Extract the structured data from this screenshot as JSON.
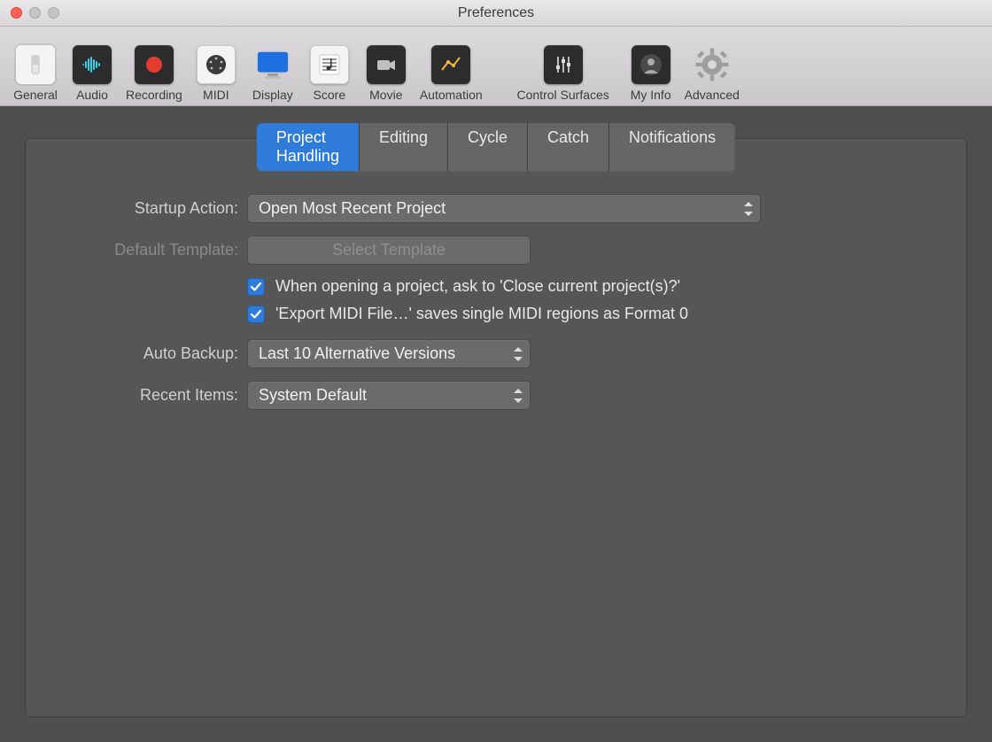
{
  "window": {
    "title": "Preferences"
  },
  "toolbar": {
    "items": [
      {
        "label": "General"
      },
      {
        "label": "Audio"
      },
      {
        "label": "Recording"
      },
      {
        "label": "MIDI"
      },
      {
        "label": "Display"
      },
      {
        "label": "Score"
      },
      {
        "label": "Movie"
      },
      {
        "label": "Automation"
      },
      {
        "label": "Control Surfaces"
      },
      {
        "label": "My Info"
      },
      {
        "label": "Advanced"
      }
    ]
  },
  "tabs": {
    "items": [
      "Project Handling",
      "Editing",
      "Cycle",
      "Catch",
      "Notifications"
    ],
    "active": "Project Handling"
  },
  "form": {
    "startup_action": {
      "label": "Startup Action:",
      "value": "Open Most Recent Project"
    },
    "default_template": {
      "label": "Default Template:",
      "button": "Select Template"
    },
    "cb_close_project": "When opening a project, ask to 'Close current project(s)?'",
    "cb_export_midi": "'Export MIDI File…' saves single MIDI regions as Format 0",
    "auto_backup": {
      "label": "Auto Backup:",
      "value": "Last 10 Alternative Versions"
    },
    "recent_items": {
      "label": "Recent Items:",
      "value": "System Default"
    }
  }
}
